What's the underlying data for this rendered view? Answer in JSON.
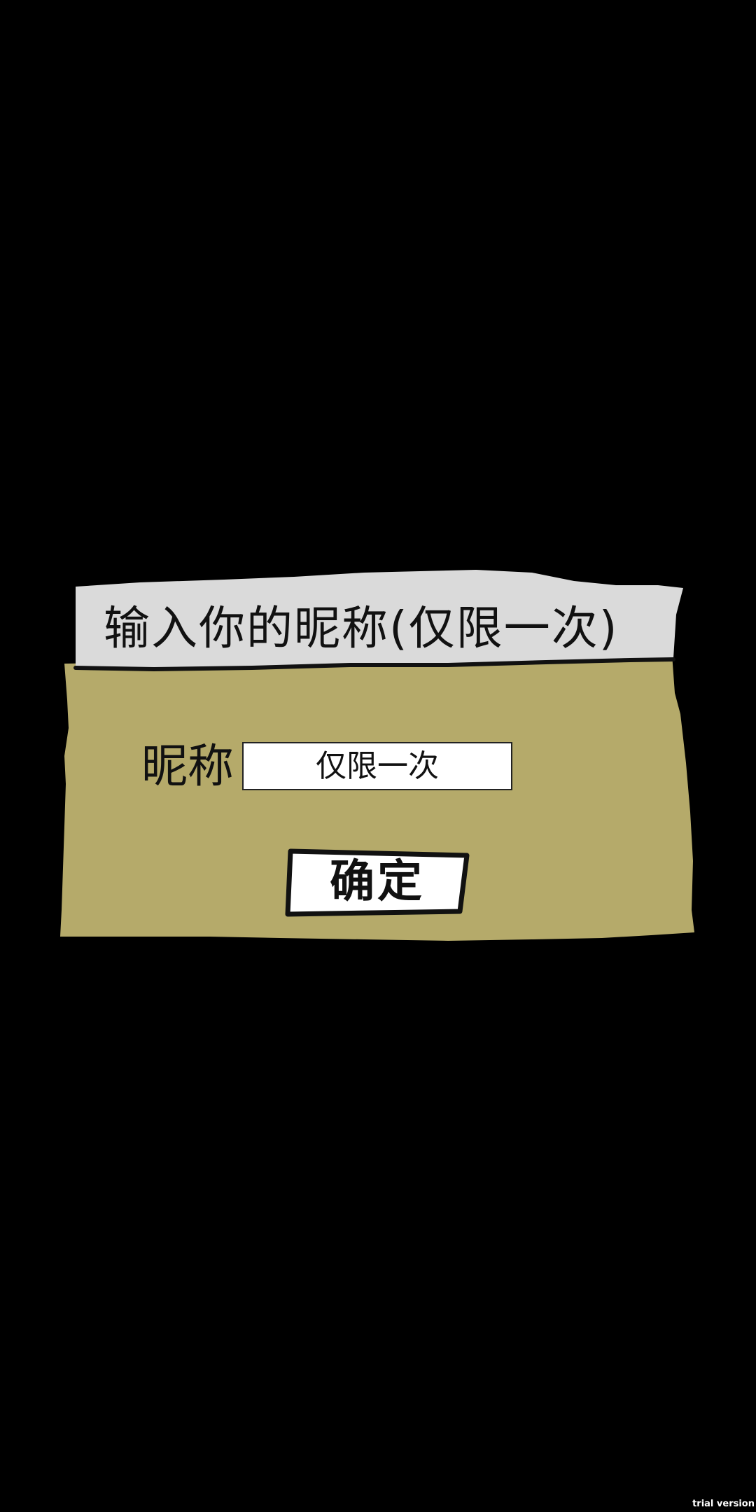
{
  "dialog": {
    "title": "输入你的昵称(仅限一次)",
    "nickname_label": "昵称",
    "nickname_placeholder": "仅限一次",
    "nickname_value": "",
    "confirm_label": "确定"
  },
  "watermark": "trial version",
  "colors": {
    "background": "#000000",
    "title_bar": "#dadada",
    "panel": "#b5aa6a",
    "input_bg": "#ffffff",
    "ink": "#111111"
  }
}
